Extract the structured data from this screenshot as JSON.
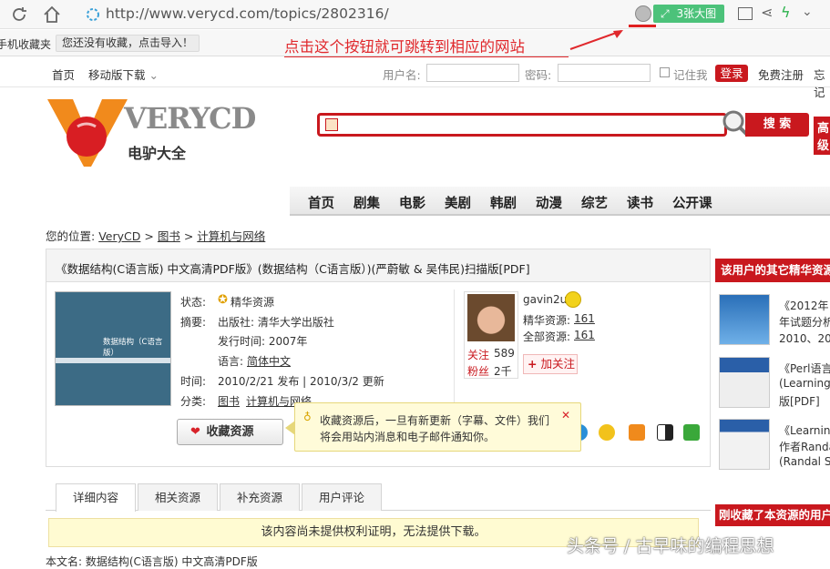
{
  "browser": {
    "url": "http://www.verycd.com/topics/2802316/",
    "bigimg_label": "3张大图"
  },
  "favbar": {
    "mobile_fav": "手机收藏夹",
    "import_hint": "您还没有收藏，点击导入！"
  },
  "annotation": "点击这个按钮就可跳转到相应的网站",
  "topnav": {
    "home": "首页",
    "mobile_download": "移动版下载",
    "username_label": "用户名:",
    "password_label": "密码:",
    "remember": "记住我",
    "login": "登录",
    "register": "免费注册",
    "forgot": "忘记"
  },
  "logo": {
    "brand": "VERYCD",
    "sub": "电驴大全"
  },
  "search": {
    "button": "搜 索",
    "advanced": "高级"
  },
  "menu": [
    "首页",
    "剧集",
    "电影",
    "美剧",
    "韩剧",
    "动漫",
    "综艺",
    "读书",
    "公开课"
  ],
  "breadcrumb": {
    "prefix": "您的位置:",
    "items": [
      "VeryCD",
      "图书",
      "计算机与网络"
    ],
    "sep": ">"
  },
  "resource": {
    "title": "《数据结构(C语言版) 中文高清PDF版》(数据结构（C语言版）)(严蔚敏 & 吴伟民)扫描版[PDF]",
    "cover_title": "数据结构（C语言版）",
    "status_label": "状态:",
    "status_value": "精华资源",
    "summary_label": "摘要:",
    "publisher": "出版社: 清华大学出版社",
    "pubtime": "发行时间: 2007年",
    "language_label": "语言:",
    "language_value": "简体中文",
    "time_label": "时间:",
    "time_value": "2010/2/21 发布 | 2010/3/2 更新",
    "category_label": "分类:",
    "category_1": "图书",
    "category_2": "计算机与网络",
    "fav_button": "收藏资源"
  },
  "user": {
    "name": "gavin2u",
    "elite_label": "精华资源:",
    "elite_count": "161",
    "all_label": "全部资源:",
    "all_count": "161",
    "follow_label": "关注",
    "follow_count": "589",
    "fans_label": "粉丝",
    "fans_count": "2千",
    "follow_button": "加关注"
  },
  "tooltip": {
    "line1": "收藏资源后，一旦有新更新（字幕、文件）我们",
    "line2": "将会用站内消息和电子邮件通知你。"
  },
  "tabs": [
    "详细内容",
    "相关资源",
    "补充资源",
    "用户评论"
  ],
  "notice": "该内容尚未提供权利证明，无法提供下载。",
  "sidebar": {
    "header": "该用户的其它精华资源",
    "items": [
      {
        "l1": "《2012年",
        "l2": "年试题分析",
        "l3": "2010、20"
      },
      {
        "l1": "《Perl语言",
        "l2": "(Learning",
        "l3": "版[PDF]"
      },
      {
        "l1": "《Learning",
        "l2": "作者Randa",
        "l3": "(Randal Sc"
      }
    ],
    "header2": "刚收藏了本资源的用户"
  },
  "watermark": "头条号 / 古早味的编程思想",
  "bottom_cut": "本文名: 数据结构(C语言版) 中文高清PDF版"
}
